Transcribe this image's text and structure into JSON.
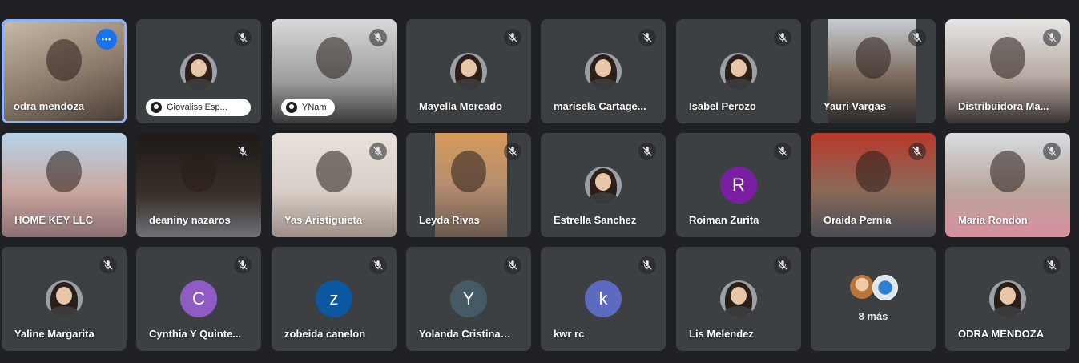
{
  "meeting": {
    "more_label": "8 más"
  },
  "colors": {
    "background": "#202124",
    "tile": "#3c4043",
    "active_border": "#8ab4f8",
    "menu_button": "#1a73e8"
  },
  "icons": {
    "muted": "mic-off-icon",
    "menu": "more-horizontal-icon",
    "presenting": "presenting-icon"
  },
  "tiles": [
    {
      "name": "odra mendoza",
      "type": "video",
      "active": true
    },
    {
      "name": "Giovaliss Esp...",
      "type": "avatar-photo",
      "presenting": true,
      "muted": true
    },
    {
      "name": "YNam",
      "type": "video",
      "presenting": true,
      "muted": true
    },
    {
      "name": "Mayella Mercado",
      "type": "avatar-photo",
      "muted": true
    },
    {
      "name": "marisela Cartage...",
      "type": "avatar-photo",
      "muted": true
    },
    {
      "name": "Isabel Perozo",
      "type": "avatar-photo",
      "muted": true
    },
    {
      "name": "Yauri Vargas",
      "type": "video",
      "muted": true
    },
    {
      "name": "Distribuidora Ma...",
      "type": "video",
      "muted": true
    },
    {
      "name": "HOME KEY LLC",
      "type": "video",
      "muted": false
    },
    {
      "name": "deaniny nazaros",
      "type": "video",
      "muted": true
    },
    {
      "name": "Yas Aristiguieta",
      "type": "video",
      "muted": true
    },
    {
      "name": "Leyda Rivas",
      "type": "video",
      "muted": true
    },
    {
      "name": "Estrella Sanchez",
      "type": "avatar-photo",
      "muted": true
    },
    {
      "name": "Roiman Zurita",
      "type": "avatar-letter",
      "letter": "R",
      "color": "#7b1fa2",
      "muted": true
    },
    {
      "name": "Oraida Pernia",
      "type": "video",
      "muted": true
    },
    {
      "name": "Maria Rondon",
      "type": "video",
      "muted": true
    },
    {
      "name": "Yaline Margarita",
      "type": "avatar-photo",
      "muted": true
    },
    {
      "name": "Cynthia Y Quinte...",
      "type": "avatar-letter",
      "letter": "C",
      "color": "#8e5cc4",
      "muted": true
    },
    {
      "name": "zobeida canelon",
      "type": "avatar-letter",
      "letter": "z",
      "color": "#0b57a0",
      "muted": true
    },
    {
      "name": "Yolanda Cristina ...",
      "type": "avatar-letter",
      "letter": "Y",
      "color": "#455a64",
      "muted": true
    },
    {
      "name": "kwr rc",
      "type": "avatar-letter",
      "letter": "k",
      "color": "#5c6bc0",
      "muted": true
    },
    {
      "name": "Lis Melendez",
      "type": "avatar-photo",
      "muted": true
    },
    {
      "name": "",
      "type": "more",
      "muted": false
    },
    {
      "name": "ODRA MENDOZA",
      "type": "avatar-photo",
      "muted": true
    }
  ]
}
